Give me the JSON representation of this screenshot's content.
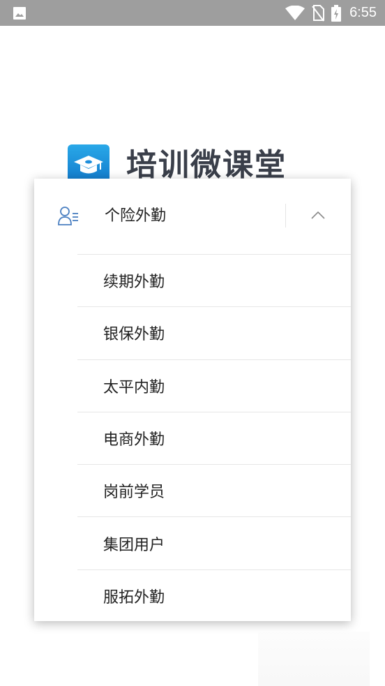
{
  "status_bar": {
    "time": "6:55",
    "icons": [
      "image-icon",
      "wifi-icon",
      "no-sim-icon",
      "battery-charging-icon"
    ]
  },
  "app": {
    "title": "培训微课堂",
    "logo_icon": "graduation-cap-icon"
  },
  "dropdown": {
    "selected": "个险外勤",
    "expanded": true,
    "toggle_icon": "chevron-up-icon",
    "options": [
      {
        "label": "续期外勤"
      },
      {
        "label": "银保外勤"
      },
      {
        "label": "太平内勤"
      },
      {
        "label": "电商外勤"
      },
      {
        "label": "岗前学员"
      },
      {
        "label": "集团用户"
      },
      {
        "label": "服拓外勤"
      }
    ]
  },
  "colors": {
    "status_bar": "#9e9e9e",
    "accent_blue": "#1e8fdc",
    "icon_blue": "#4a7fc1",
    "title_text": "#3a3f4a",
    "item_text": "#222222"
  }
}
